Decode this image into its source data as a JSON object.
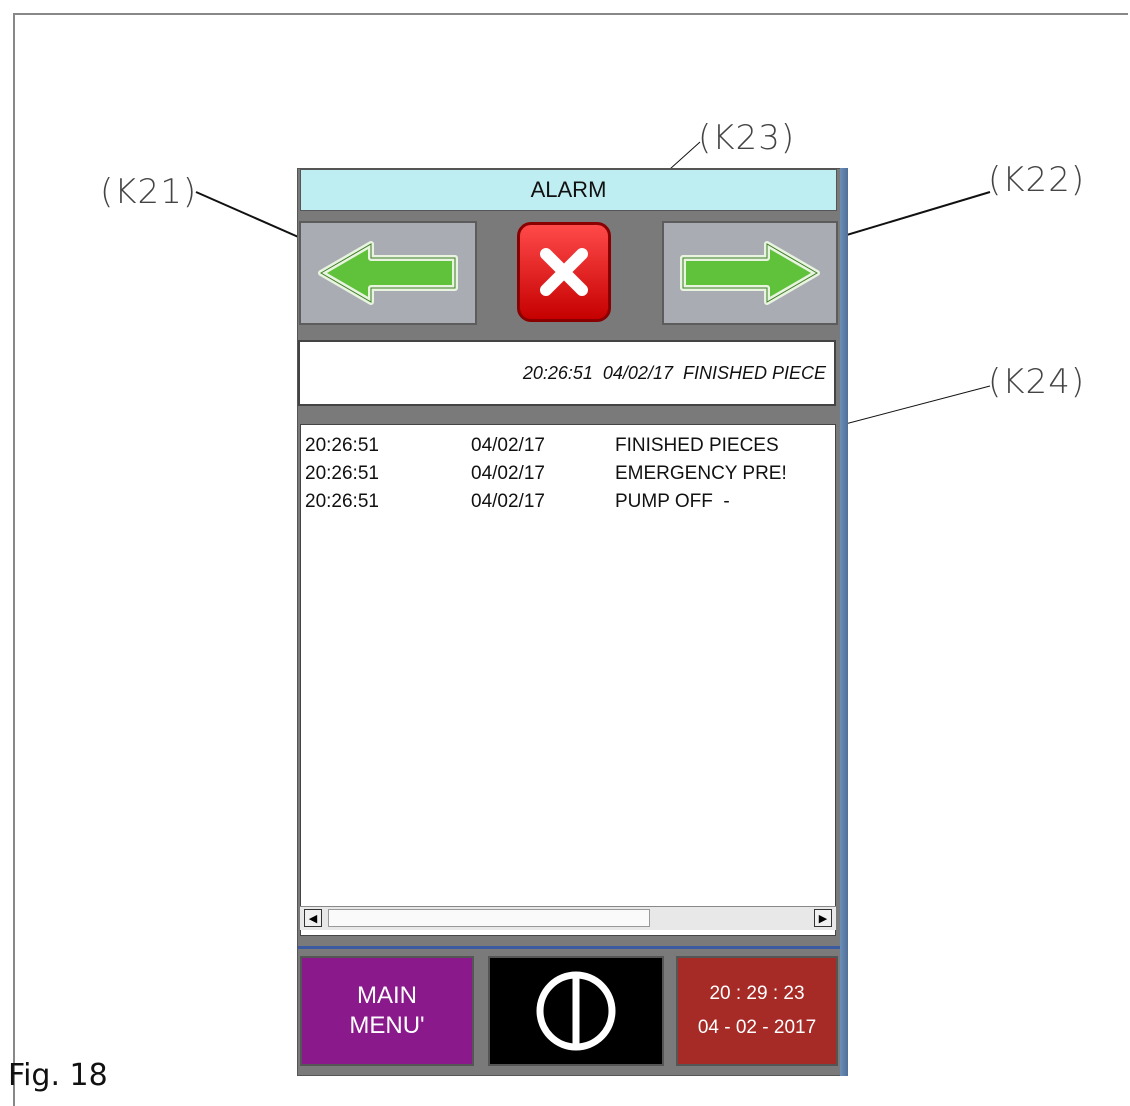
{
  "figure": {
    "caption": "Fig. 18",
    "callouts": {
      "k21": "(K21)",
      "k22": "(K22)",
      "k23": "(K23)",
      "k24": "(K24)"
    }
  },
  "screen": {
    "title": "ALARM",
    "toolbar": {
      "prev_icon": "left-arrow-icon",
      "close_icon": "close-x-icon",
      "next_icon": "right-arrow-icon"
    },
    "status_line": "20:26:51  04/02/17  FINISHED PIECE",
    "alarm_list": [
      {
        "time": "20:26:51",
        "date": "04/02/17",
        "message": "FINISHED PIECES"
      },
      {
        "time": "20:26:51",
        "date": "04/02/17",
        "message": "EMERGENCY PRE!"
      },
      {
        "time": "20:26:51",
        "date": "04/02/17",
        "message": "PUMP OFF  -"
      }
    ],
    "footer": {
      "main_menu_line1": "MAIN",
      "main_menu_line2": "MENU'",
      "power_icon": "power-icon",
      "clock_time": "20 : 29 : 23",
      "clock_date": "04 - 02 - 2017"
    },
    "colors": {
      "title_bg": "#bfeef2",
      "arrow_green": "#5fc23a",
      "close_red": "#e01010",
      "main_menu_bg": "#8a1a8c",
      "clock_bg": "#a62b26"
    }
  }
}
